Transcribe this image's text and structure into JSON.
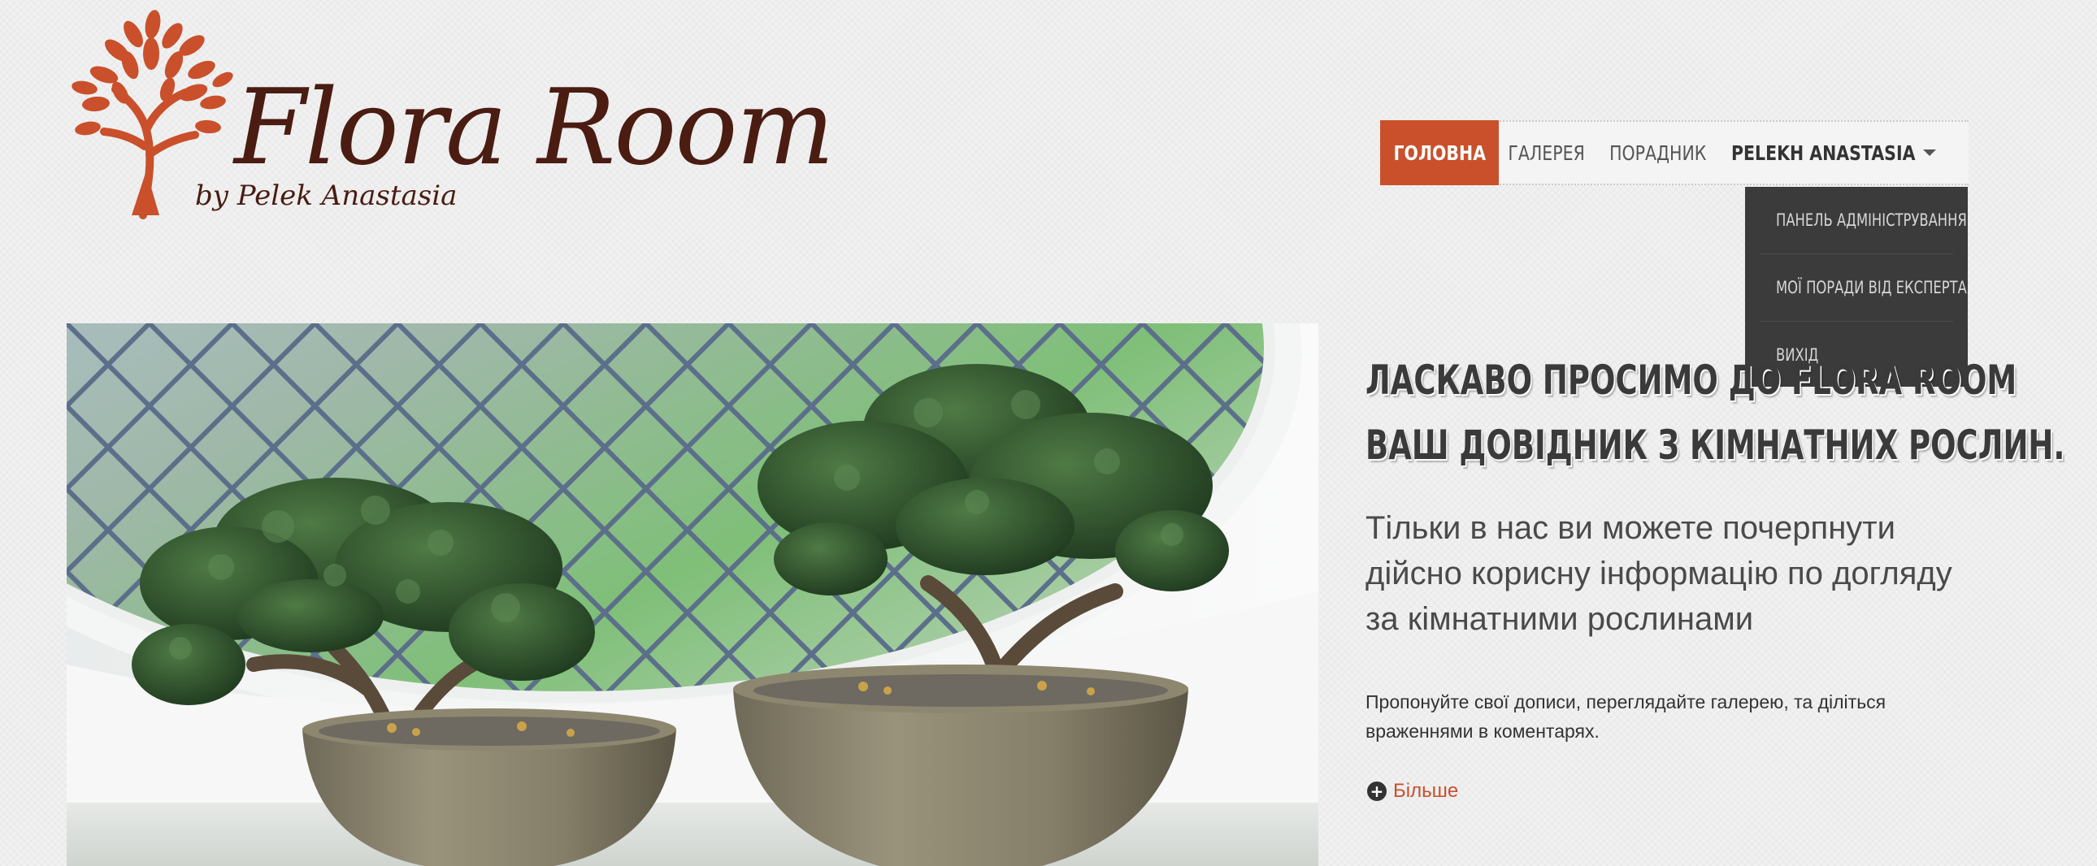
{
  "logo": {
    "title": "Flora Room",
    "subtitle": "by Pelek Anastasia",
    "icon": "tree-icon",
    "color": "#c9502b"
  },
  "nav": {
    "items": [
      {
        "label": "ГОЛОВНА",
        "active": true
      },
      {
        "label": "ГАЛЕРЕЯ",
        "active": false
      },
      {
        "label": "ПОРАДНИК",
        "active": false
      }
    ],
    "user_label": "PELEKH ANASTASIA",
    "user_icon": "chevron-down-icon",
    "active_color": "#c9502b"
  },
  "dropdown": {
    "items": [
      {
        "label": "ПАНЕЛЬ АДМІНІСТРУВАННЯ"
      },
      {
        "label": "МОЇ ПОРАДИ ВІД ЕКСПЕРТА"
      },
      {
        "label": "ВИХІД"
      }
    ],
    "background": "#3b3b3b"
  },
  "hero": {
    "line1": "ЛАСКАВО ПРОСИМО ДО FLORA ROOM",
    "line2": "ВАШ ДОВІДНИК З КІМНАТНИХ РОСЛИН.",
    "lead": "Тільки в нас ви можете почерпнути дійсно корисну інформацію по догляду за кімнатними рослинами",
    "body": "Пропонуйте свої дописи, переглядайте галерею, та діліться враженнями в коментарях.",
    "more_label": "Більше",
    "more_icon": "plus-circle-icon"
  }
}
